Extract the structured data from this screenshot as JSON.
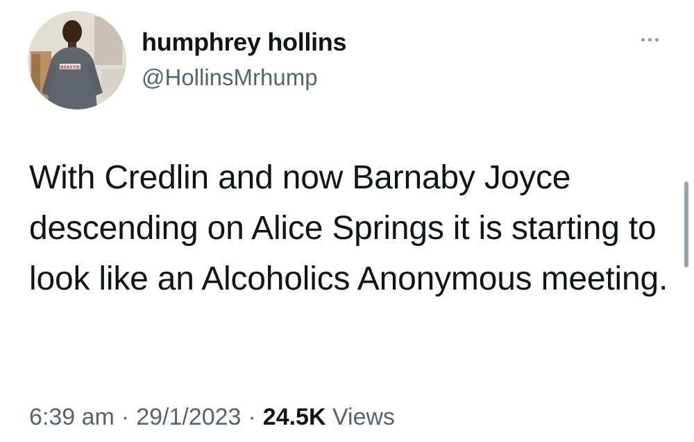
{
  "author": {
    "display_name": "humphrey hollins",
    "handle": "@HollinsMrhump",
    "avatar_shirt_text": "BEASTIE"
  },
  "tweet": {
    "text": "With Credlin and now Barnaby Joyce descending on Alice Springs it is starting to look like an Alcoholics Anonymous meeting."
  },
  "meta": {
    "time": "6:39 am",
    "separator": "·",
    "date": "29/1/2023",
    "views_count": "24.5K",
    "views_label": "Views"
  },
  "icons": {
    "more": "more-horizontal-icon"
  },
  "colors": {
    "text_primary": "#0f1419",
    "text_secondary": "#536471",
    "background": "#ffffff"
  }
}
